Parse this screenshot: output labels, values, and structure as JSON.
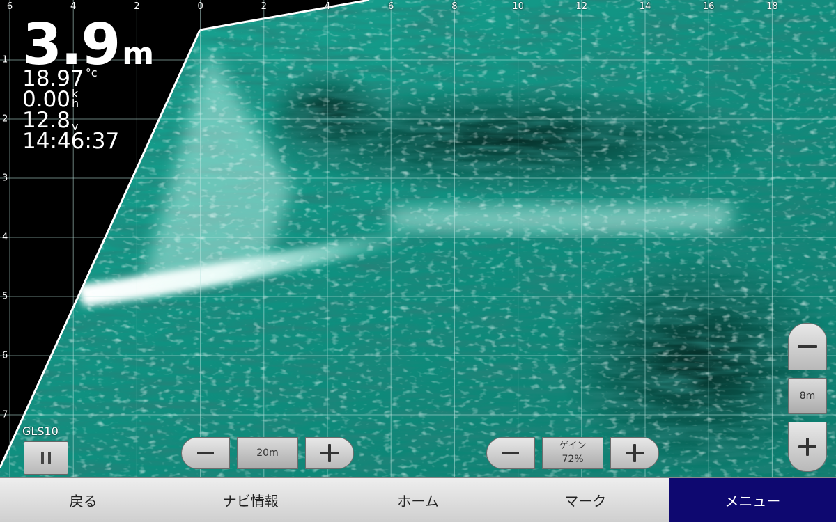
{
  "readouts": {
    "depth_value": "3.9",
    "depth_unit": "m",
    "water_temp": "18.97",
    "water_temp_unit": "°c",
    "speed": "0.00",
    "speed_unit_top": "k",
    "speed_unit_bottom": "h",
    "voltage": "12.8",
    "voltage_unit": "v",
    "time": "14:46:37"
  },
  "top_scale": [
    "6",
    "4",
    "2",
    "0",
    "2",
    "4",
    "6",
    "8",
    "10",
    "12",
    "14",
    "16",
    "18"
  ],
  "left_scale": [
    "1",
    "2",
    "3",
    "4",
    "5",
    "6",
    "7"
  ],
  "transducer": {
    "label": "GLS10",
    "pause_icon": "pause-icon"
  },
  "range_control": {
    "value": "20m"
  },
  "gain_control": {
    "label": "ゲイン",
    "value": "72%",
    "level": 0.72
  },
  "zoom_control": {
    "value": "8m"
  },
  "nav": {
    "back": "戻る",
    "navi_info": "ナビ情報",
    "home": "ホーム",
    "mark": "マーク",
    "menu": "メニュー"
  },
  "colors": {
    "sonar_base": "#0e8d7e",
    "sonar_bright": "#e6fffb",
    "sonar_dark": "#06241f",
    "menu_active": "#0e0870"
  }
}
